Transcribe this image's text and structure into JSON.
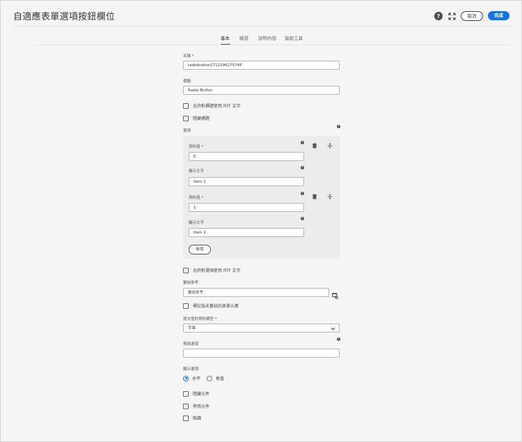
{
  "header": {
    "title": "自適應表單選項按鈕欄位",
    "help_icon": "help-icon",
    "expand_icon": "expand-icon",
    "cancel_label": "取消",
    "done_label": "完成",
    "accent_color": "#1473e6"
  },
  "tabs": [
    {
      "label": "基本",
      "active": true
    },
    {
      "label": "驗證",
      "active": false
    },
    {
      "label": "說明內容",
      "active": false
    },
    {
      "label": "協助工具",
      "active": false
    }
  ],
  "form": {
    "name_label": "名稱",
    "name_value": "radiobutton1712396275745",
    "title_label": "標題",
    "title_value": "Radio Button",
    "allow_rtf_title": "允許對標題使用 RTF 文字",
    "hide_title": "隱藏標題",
    "options_label": "選項",
    "options": [
      {
        "value_label": "資料值",
        "value": "0",
        "text_label": "顯示文字",
        "text": "Item 1"
      },
      {
        "value_label": "資料值",
        "value": "1",
        "text_label": "顯示文字",
        "text": "Item 2"
      }
    ],
    "add_label": "新增",
    "allow_rtf_options": "允許對選項使用 RTF 文字",
    "bind_ref_label": "繫結參考",
    "bind_ref_placeholder": "繫結參考",
    "mark_unbound": "標記為未繫結的表單元素",
    "submit_type_label": "提交值的資料類型",
    "submit_type_value": "字串",
    "default_label": "預設選項",
    "default_value": "",
    "display_label": "顯示選項",
    "display_options": [
      {
        "label": "水平",
        "selected": true
      },
      {
        "label": "垂直",
        "selected": false
      }
    ],
    "hide_component": "隱藏元件",
    "disable_component": "停用元件",
    "readonly": "唯讀",
    "required_marker": "*"
  }
}
